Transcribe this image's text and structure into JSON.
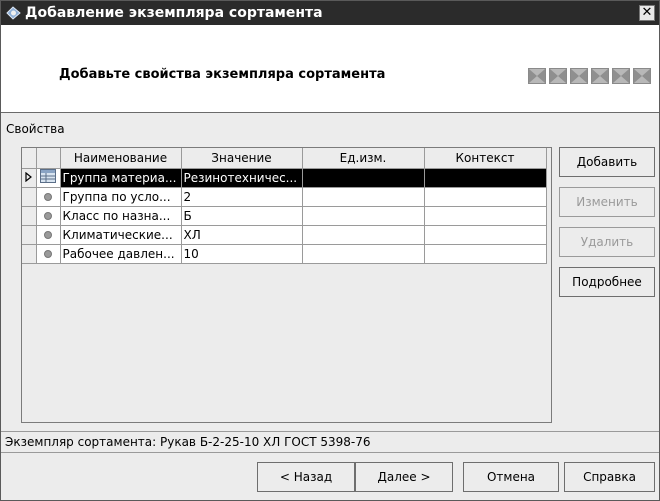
{
  "window": {
    "title": "Добавление экземпляра сортамента",
    "close_symbol": "✕"
  },
  "header": {
    "text": "Добавьте свойства экземпляра сортамента",
    "step_icons": 6
  },
  "section_label": "Свойства",
  "table": {
    "columns": [
      "Наименование",
      "Значение",
      "Ед.изм.",
      "Контекст"
    ],
    "rows": [
      {
        "name": "Группа материа...",
        "value": "Резинотехничес...",
        "unit": "",
        "context": "",
        "icon": "group-table-icon",
        "selected": true
      },
      {
        "name": "Группа по усло...",
        "value": "2",
        "unit": "",
        "context": "",
        "icon": "dot-icon",
        "selected": false
      },
      {
        "name": "Класс по назна...",
        "value": "Б",
        "unit": "",
        "context": "",
        "icon": "dot-icon",
        "selected": false
      },
      {
        "name": "Климатические...",
        "value": "ХЛ",
        "unit": "",
        "context": "",
        "icon": "dot-icon",
        "selected": false
      },
      {
        "name": "Рабочее давлен...",
        "value": "10",
        "unit": "",
        "context": "",
        "icon": "dot-icon",
        "selected": false
      }
    ]
  },
  "side_buttons": {
    "add": "Добавить",
    "edit": "Изменить",
    "delete": "Удалить",
    "details": "Подробнее"
  },
  "status_text": "Экземпляр сортамента: Рукав Б-2-25-10 ХЛ ГОСТ 5398-76",
  "nav_buttons": {
    "back": "< Назад",
    "next": "Далее >",
    "cancel": "Отмена",
    "help": "Справка"
  },
  "colors": {
    "titlebar": "#2b2b2b",
    "selection": "#000000",
    "window_bg": "#ececec"
  }
}
